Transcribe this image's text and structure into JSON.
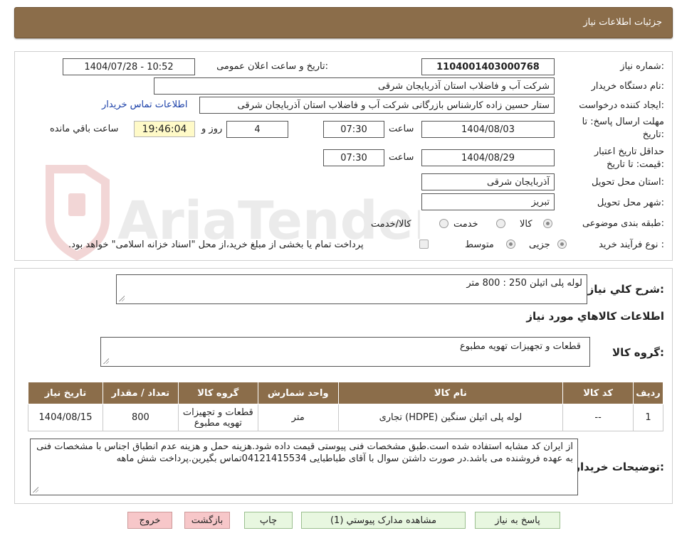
{
  "header": {
    "title": "جزئیات اطلاعات نیاز"
  },
  "watermark": {
    "text": "AriaTender.neT"
  },
  "form": {
    "need_number": {
      "label": "شماره نیاز:",
      "value": "1104001403000768"
    },
    "announce": {
      "label": "تاریخ و ساعت اعلان عمومی:",
      "value": "1404/07/28 - 10:52"
    },
    "buyer": {
      "label": "نام دستگاه خریدار:",
      "value": "شرکت آب و فاضلاب استان آذربایجان شرقی"
    },
    "requester": {
      "label": "ایجاد کننده درخواست:",
      "value": "ستار حسین زاده کارشناس بازرگانی شرکت آب و فاضلاب استان آذربایجان شرقی",
      "contact_link": "اطلاعات تماس خریدار"
    },
    "deadline": {
      "label_line1": "مهلت ارسال پاسخ: تا",
      "label_line2": "تاریخ:",
      "date": "1404/08/03",
      "time_label": "ساعت",
      "time": "07:30",
      "days": "4",
      "days_label": "روز و",
      "remaining": "19:46:04",
      "remaining_label": "ساعت باقي مانده"
    },
    "validity": {
      "label_line1": "حداقل تاریخ اعتبار",
      "label_line2": "قیمت: تا تاریخ:",
      "date": "1404/08/29",
      "time_label": "ساعت",
      "time": "07:30"
    },
    "province": {
      "label": "استان محل تحویل:",
      "value": "آذربایجان شرقی"
    },
    "city": {
      "label": "شهر محل تحویل:",
      "value": "تبریز"
    },
    "category": {
      "label": "طبقه بندی موضوعی:",
      "options": [
        "کالا",
        "خدمت",
        "کالا/خدمت"
      ],
      "selected": "کالا"
    },
    "process": {
      "label": "نوع فرآیند خرید :",
      "options": [
        "جزیی",
        "متوسط"
      ],
      "selected": "جزیی",
      "payment_note": "پرداخت تمام یا بخشی از مبلغ خرید،از محل \"اسناد خزانه اسلامی\" خواهد بود."
    }
  },
  "summary": {
    "label": "شرح کلي نياز:",
    "value": "لوله پلی اتیلن 250 : 800 متر",
    "items_heading": "اطلاعات کالاهاي مورد نياز",
    "group_label": "گروه کالا:",
    "group_value": "قطعات و تجهیزات تهویه مطبوع"
  },
  "table": {
    "headers": [
      "ردیف",
      "کد کالا",
      "نام کالا",
      "واحد شمارش",
      "گروه کالا",
      "تعداد / مقدار",
      "تاریخ نیاز"
    ],
    "rows": [
      {
        "row": "1",
        "code": "--",
        "name": "لوله پلی اتیلن سنگین (HDPE) تجاری",
        "unit": "متر",
        "group": "قطعات و تجهیزات تهویه مطبوع",
        "qty": "800",
        "date": "1404/08/15"
      }
    ]
  },
  "buyer_notes": {
    "label": "توضیحات خریدار:",
    "value": "از ایران کد مشابه استفاده شده است.طبق مشخصات فنی پیوستی قیمت داده شود.هزینه حمل و هزینه عدم انطباق اجناس با مشخصات فنی به عهده فروشنده می باشد.در صورت داشتن سوال با آقای طباطبایی 04121415534تماس بگیرین.پرداخت شش ماهه"
  },
  "buttons": {
    "reply": "پاسخ به نیاز",
    "attachments": "مشاهده مدارک پیوستي (1)",
    "print": "چاپ",
    "back": "بازگشت",
    "exit": "خروج"
  }
}
